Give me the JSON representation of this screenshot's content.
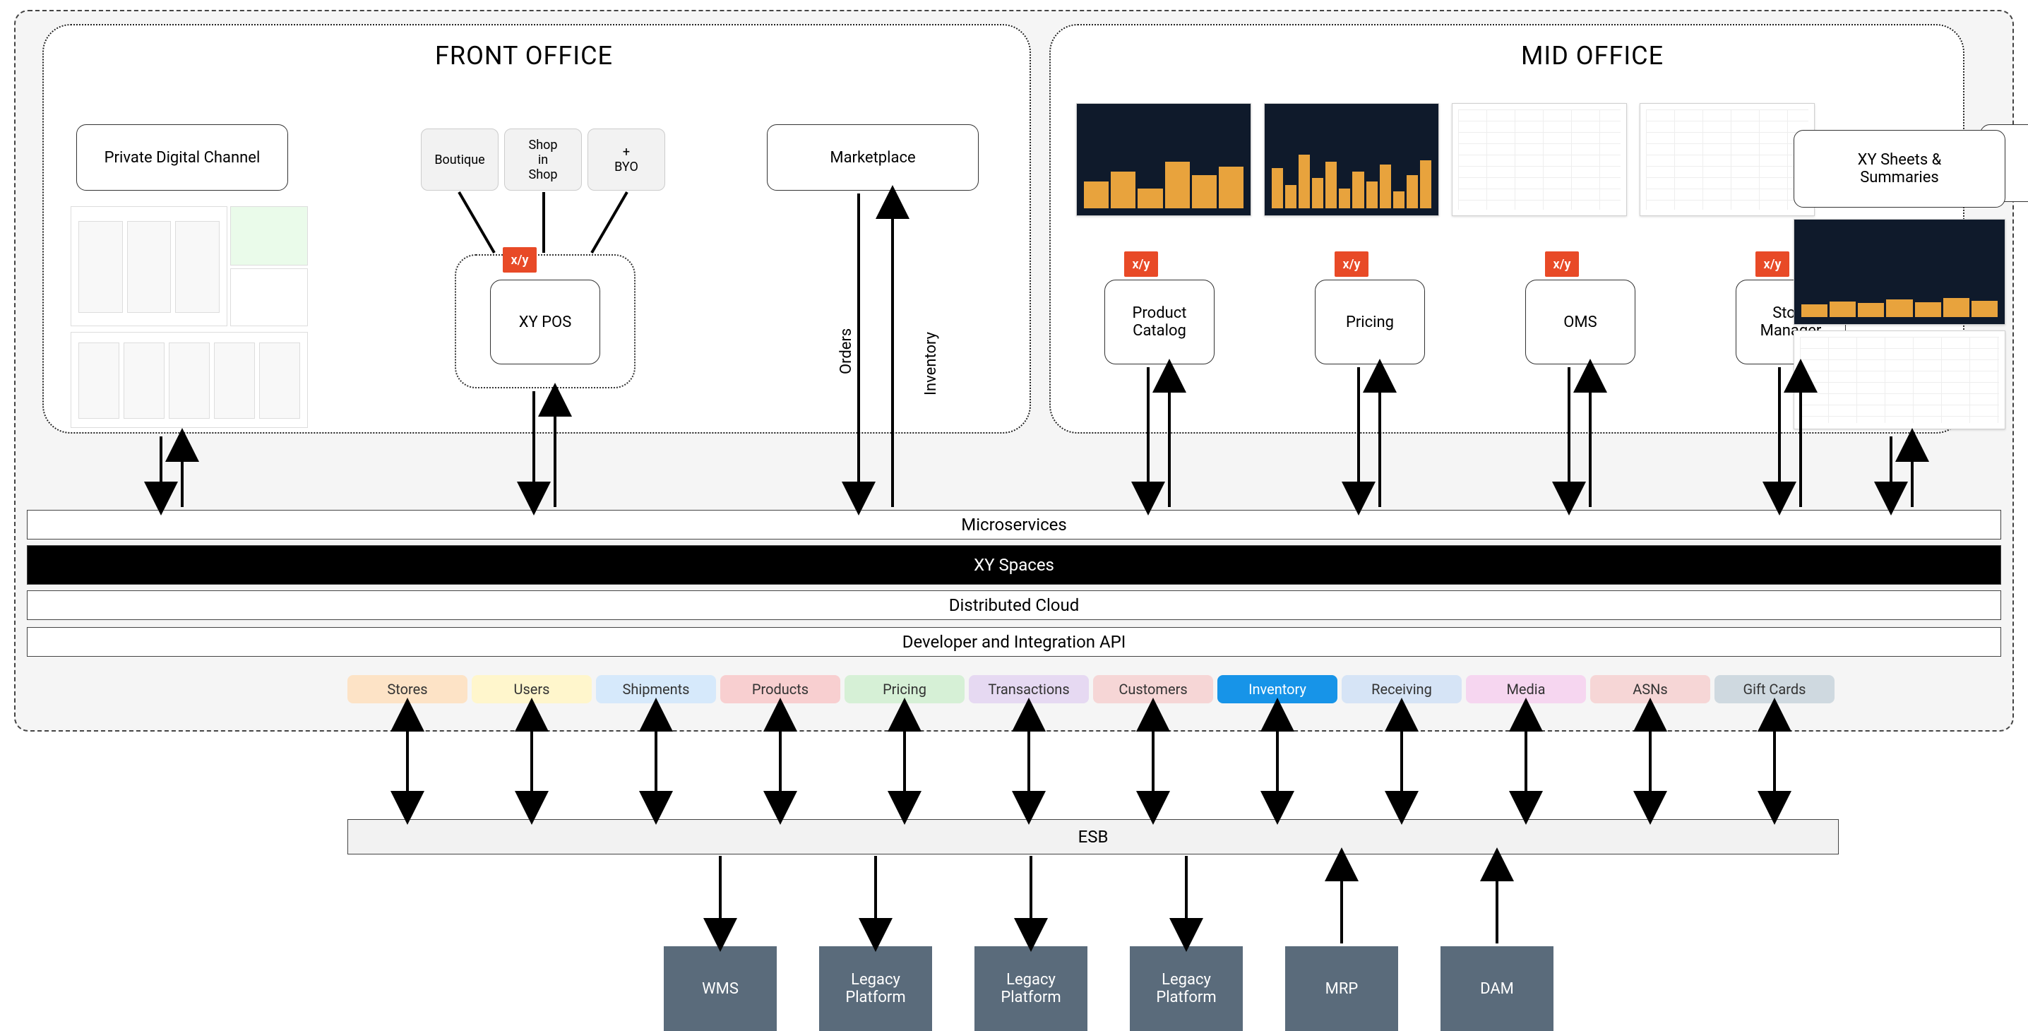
{
  "zones": {
    "front_office": "FRONT OFFICE",
    "mid_office": "MID OFFICE"
  },
  "front": {
    "private_digital_channel": "Private Digital Channel",
    "marketplace": "Marketplace",
    "pos_chips": {
      "boutique": "Boutique",
      "shop_in_shop": "Shop\nin\nShop",
      "byo": "+\nBYO"
    },
    "xy_pos": "XY POS",
    "orders_label": "Orders",
    "inventory_label": "Inventory"
  },
  "mid": {
    "product_catalog": "Product\nCatalog",
    "pricing": "Pricing",
    "oms": "OMS",
    "store_manager": "Store\nManager",
    "xy_sheets": "XY Sheets &\nSummaries"
  },
  "xy_tag": "x/y",
  "layers": {
    "microservices": "Microservices",
    "xy_spaces": "XY Spaces",
    "distributed_cloud": "Distributed Cloud",
    "dev_api": "Developer and Integration API"
  },
  "api_chips": [
    {
      "label": "Stores",
      "color": "#fde3c6"
    },
    {
      "label": "Users",
      "color": "#fff6cc"
    },
    {
      "label": "Shipments",
      "color": "#d6e9fb"
    },
    {
      "label": "Products",
      "color": "#f8cfd0"
    },
    {
      "label": "Pricing",
      "color": "#d6f0d6"
    },
    {
      "label": "Transactions",
      "color": "#e6d9f2"
    },
    {
      "label": "Customers",
      "color": "#f6d6d6"
    },
    {
      "label": "Inventory",
      "color": "#1794e8",
      "text": "#fff"
    },
    {
      "label": "Receiving",
      "color": "#d6e4f6"
    },
    {
      "label": "Media",
      "color": "#f6d6f0"
    },
    {
      "label": "ASNs",
      "color": "#f6d6d6"
    },
    {
      "label": "Gift Cards",
      "color": "#cfd9e0"
    }
  ],
  "esb": "ESB",
  "systems": [
    {
      "label": "WMS"
    },
    {
      "label": "Legacy\nPlatform"
    },
    {
      "label": "Legacy\nPlatform"
    },
    {
      "label": "Legacy\nPlatform"
    },
    {
      "label": "MRP"
    },
    {
      "label": "DAM"
    }
  ]
}
